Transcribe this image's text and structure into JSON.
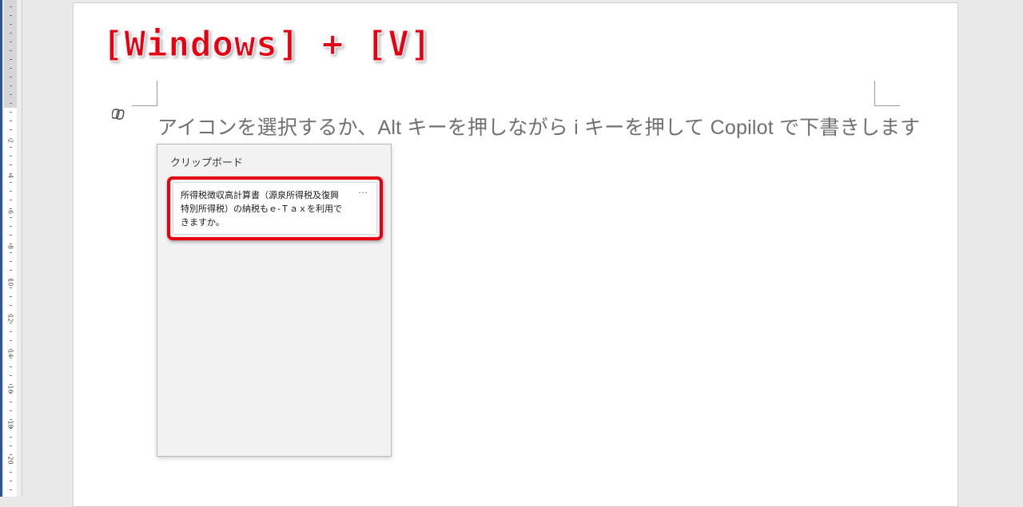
{
  "overlay": {
    "title": "[Windows] + [V]",
    "color": "#e60012"
  },
  "document": {
    "copilot_hint": "アイコンを選択するか、Alt キーを押しながら i キーを押して Copilot で下書きします",
    "copilot_icon": "copilot-icon"
  },
  "ruler": {
    "labels": [
      "2",
      "4",
      "6",
      "8",
      "10",
      "12",
      "14",
      "16",
      "18",
      "20"
    ]
  },
  "clipboard": {
    "title": "クリップボード",
    "items": [
      {
        "text": "所得税徴収高計算書（源泉所得税及復興特別所得税）の納税もｅ-Ｔａｘを利用できますか。",
        "more_label": "…"
      }
    ]
  }
}
